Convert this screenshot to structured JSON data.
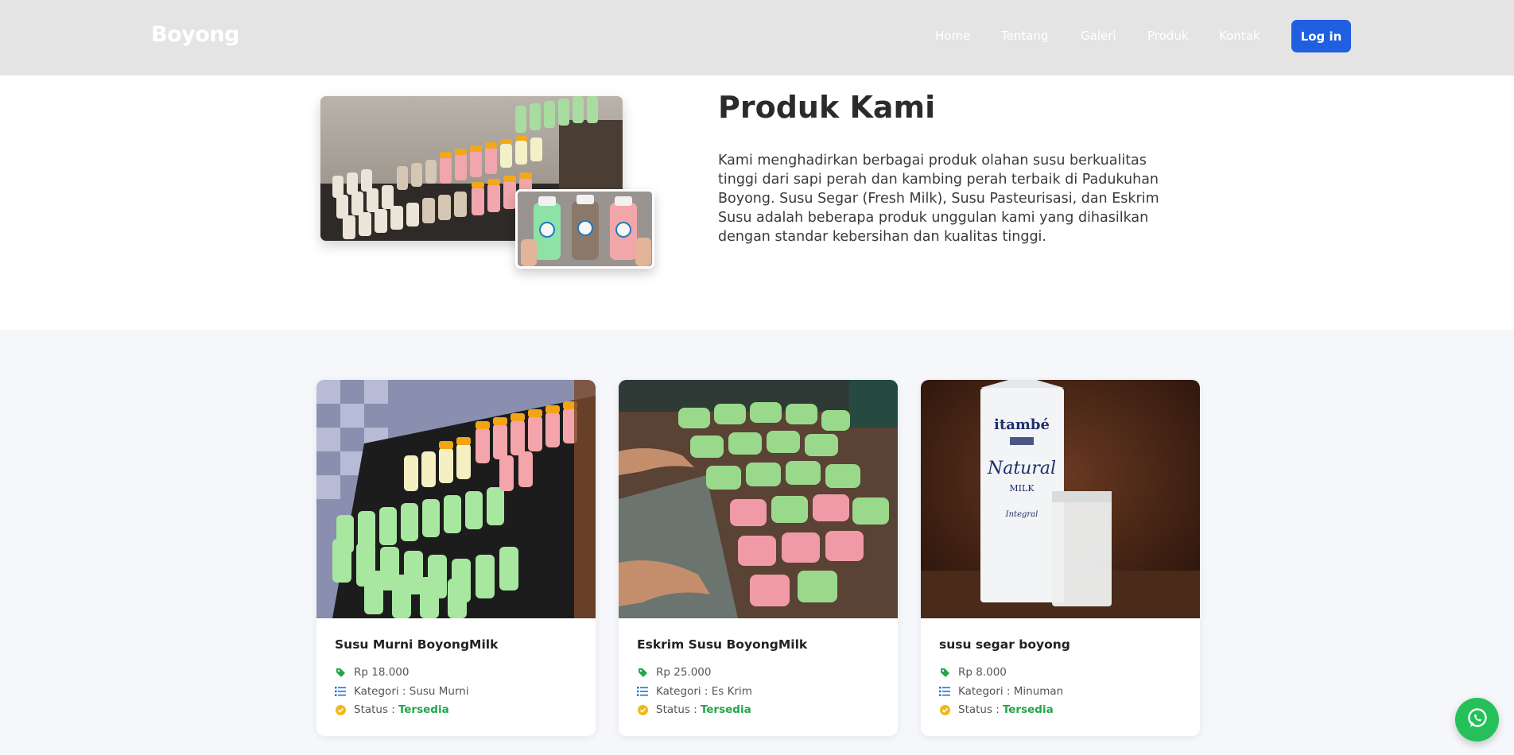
{
  "header": {
    "brand": "Boyong",
    "nav": [
      "Home",
      "Tentang",
      "Galeri",
      "Produk",
      "Kontak"
    ],
    "login_label": "Log in",
    "accent_color": "#1f5fe0"
  },
  "intro": {
    "title": "Produk Kami",
    "text": "Kami menghadirkan berbagai produk olahan susu berkualitas tinggi dari sapi perah dan kambing perah terbaik di Padukuhan Boyong. Susu Segar (Fresh Milk), Susu Pasteurisasi, dan Eskrim Susu adalah beberapa produk unggulan kami yang dihasilkan dengan standar kebersihan dan kualitas tinggi."
  },
  "products": [
    {
      "title": "Susu Murni BoyongMilk",
      "price": "Rp 18.000",
      "category": "Kategori : Susu Murni",
      "status_label": "Status :",
      "status_value": "Tersedia"
    },
    {
      "title": "Eskrim Susu BoyongMilk",
      "price": "Rp 25.000",
      "category": "Kategori : Es Krim",
      "status_label": "Status :",
      "status_value": "Tersedia"
    },
    {
      "title": "susu segar boyong",
      "price": "Rp 8.000",
      "category": "Kategori : Minuman",
      "status_label": "Status :",
      "status_value": "Tersedia"
    }
  ],
  "icons": {
    "price": "tag-icon",
    "category": "list-icon",
    "status": "check-circle-icon",
    "floating": "whatsapp-icon"
  },
  "colors": {
    "status": "#1fa84a",
    "tag": "#1fa84a",
    "list": "#1f6fe0",
    "check": "#f2b818",
    "whatsapp": "#25c05a"
  }
}
